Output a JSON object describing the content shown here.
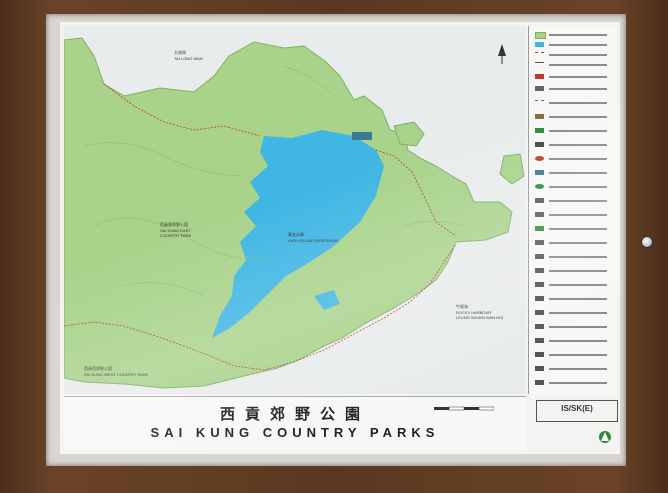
{
  "title": {
    "chinese": "西貢郊野公園",
    "english": "SAI KUNG COUNTRY PARKS"
  },
  "sheet_number": "IS/SK(E)",
  "map_labels": [
    {
      "key": "sai_kung_east",
      "zh": "西貢東郊野公園",
      "en_line1": "SAI KUNG EAST",
      "en_line2": "COUNTRY PARK"
    },
    {
      "key": "high_island",
      "zh": "萬宜水庫",
      "en_line1": "HIGH ISLAND RESERVOIR"
    },
    {
      "key": "rocky_harbour",
      "zh": "牛尾海",
      "en_line1": "ROCKY HARBOUR",
      "en_line2": "LEUNG SHUEN WAN HOI"
    },
    {
      "key": "sai_kung_west",
      "zh": "西貢西郊野公園",
      "en_line1": "SAI KUNG WEST COUNTRY PARK"
    },
    {
      "key": "tai_long_wan",
      "zh": "大浪灣",
      "en_line1": "TAI LONG WAN"
    }
  ],
  "colors": {
    "land": "#a9d38b",
    "land_edge": "#7fae64",
    "water": "#3fb6e3",
    "sea": "#e8ecec",
    "trail": "#c0392b",
    "frame": "#5a3820"
  },
  "icons": [
    "north-arrow-icon",
    "scale-bar-icon",
    "agency-logo-icon"
  ]
}
